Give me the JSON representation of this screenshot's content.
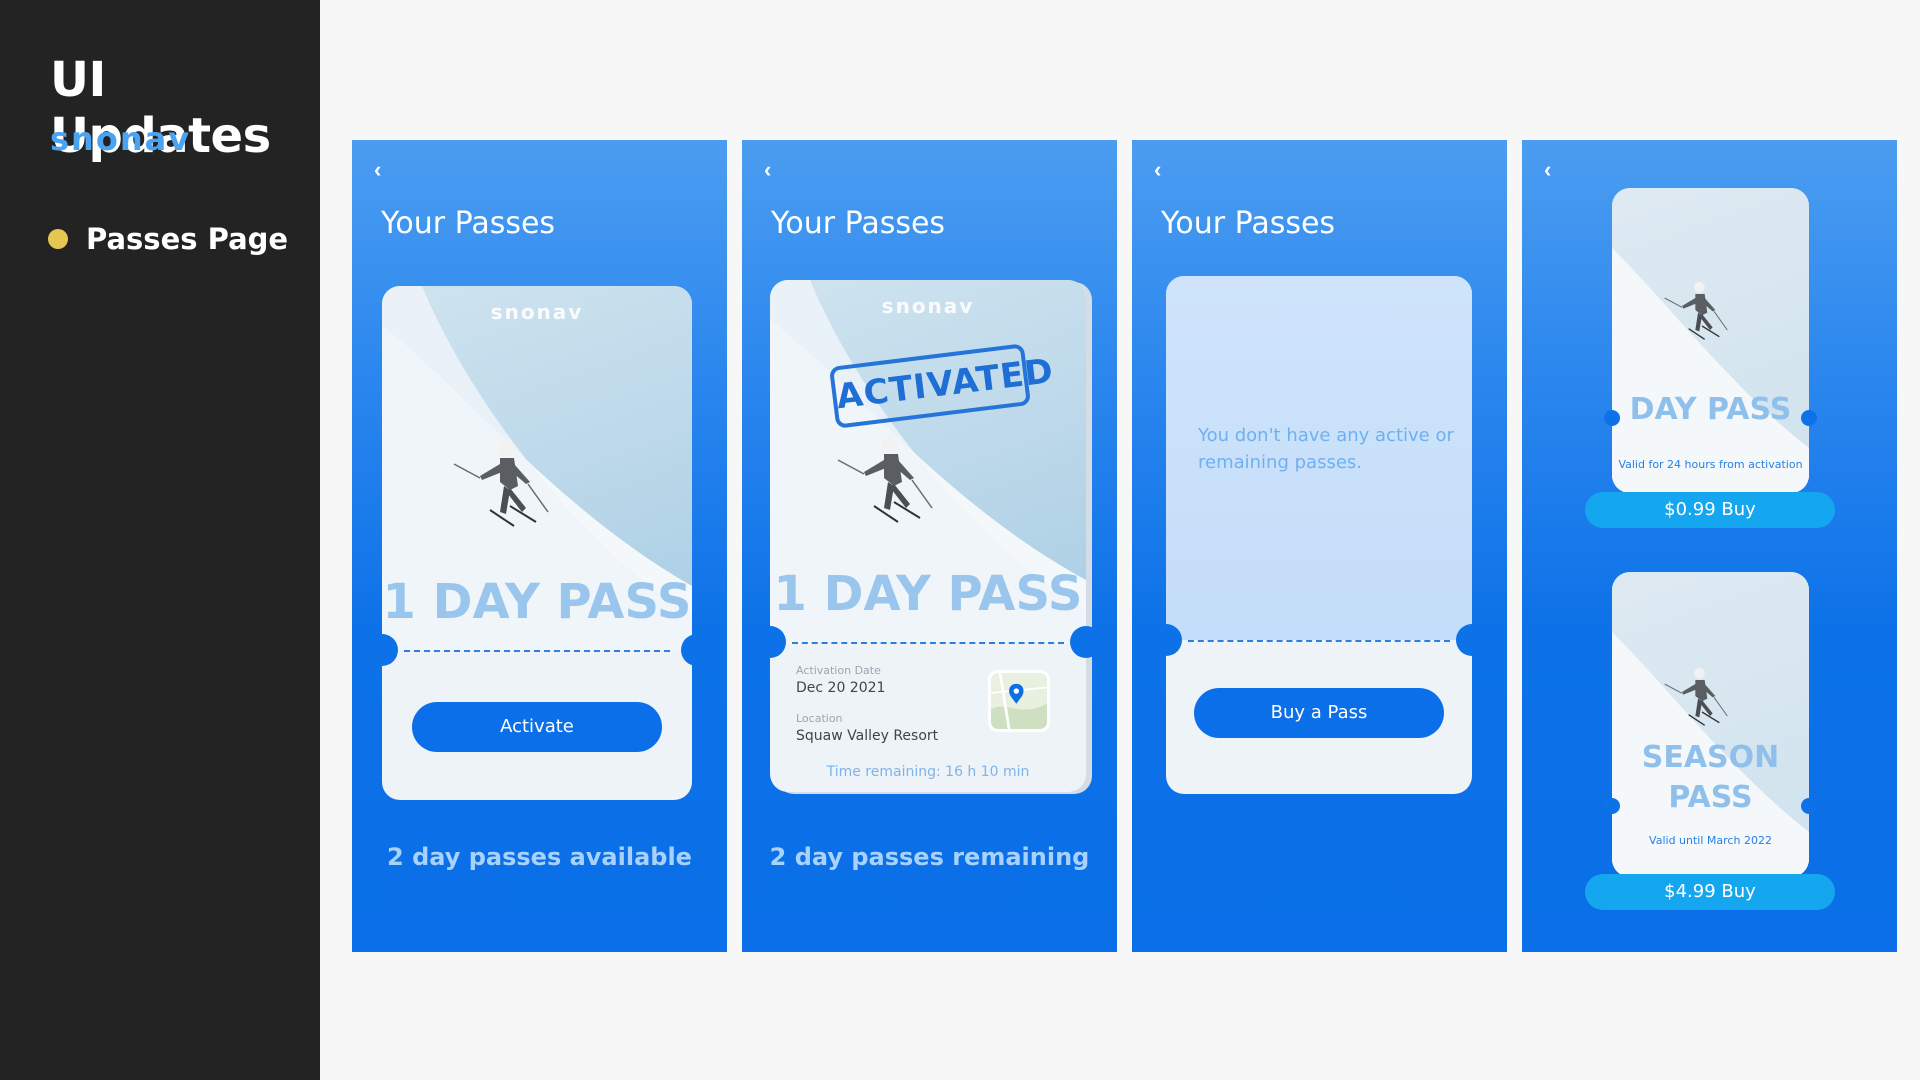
{
  "sidebar": {
    "title": "UI Updates",
    "logo": "snonav",
    "items": [
      {
        "label": "Passes Page",
        "dot_color": "#e5c652"
      }
    ]
  },
  "screens": [
    {
      "title": "Your Passes",
      "card": {
        "logo": "snonav",
        "pass_name": "1 DAY PASS",
        "button": "Activate"
      },
      "bottom_text": "2 day passes available"
    },
    {
      "title": "Your Passes",
      "card": {
        "logo": "snonav",
        "stamp": "ACTIVATED",
        "pass_name": "1 DAY PASS",
        "activation_label": "Activation Date",
        "activation_value": "Dec 20 2021",
        "location_label": "Location",
        "location_value": "Squaw Valley Resort",
        "time_remaining_label": "Time remaining:",
        "time_remaining_value": "16 h 10 min"
      },
      "bottom_text": "2 day passes remaining"
    },
    {
      "title": "Your Passes",
      "card": {
        "empty_message": "You don't have any active or remaining passes.",
        "button": "Buy a Pass"
      }
    },
    {
      "passes": [
        {
          "name": "DAY PASS",
          "valid": "Valid for 24 hours from activation",
          "price": "$0.99",
          "buy": "Buy"
        },
        {
          "name_line1": "SEASON",
          "name_line2": "PASS",
          "valid": "Valid until March 2022",
          "price": "$4.99",
          "buy": "Buy"
        }
      ]
    }
  ],
  "colors": {
    "sidebar_bg": "#232323",
    "screen_blue": "#0a6fe8",
    "buy_button": "#14a7ef",
    "accent_dot": "#e5c652"
  }
}
